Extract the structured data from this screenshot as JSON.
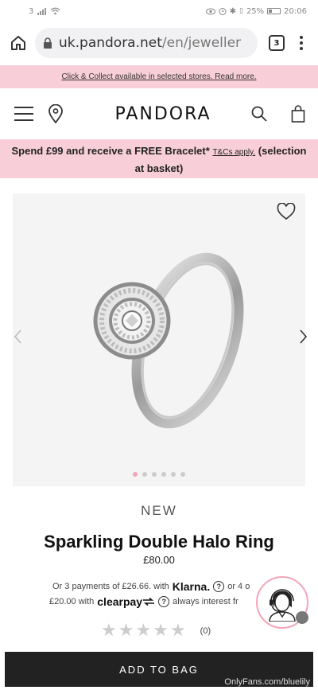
{
  "status_bar": {
    "left_text": "3",
    "battery": "25%",
    "time": "20:06"
  },
  "browser": {
    "url_host": "uk.pandora.net",
    "url_path": "/en/jeweller",
    "tab_count": "3"
  },
  "top_banner": {
    "text": "Click & Collect available in selected stores. Read more."
  },
  "header": {
    "logo": "PANDORA"
  },
  "promo": {
    "text_main": "Spend £99 and receive a FREE Bracelet*",
    "tc_link": "T&Cs apply.",
    "text_tail": "(selection at basket)"
  },
  "gallery": {
    "image_count": 6,
    "active_index": 0
  },
  "product": {
    "tag": "NEW",
    "title": "Sparkling Double Halo Ring",
    "price": "£80.00"
  },
  "payments": {
    "line1_prefix": "Or 3 payments of £26.66. with",
    "klarna": "Klarna.",
    "line1_suffix": "or 4 o",
    "line2_prefix": "£20.00 with",
    "clearpay": "clearpay",
    "line2_suffix": "always interest fr"
  },
  "rating": {
    "stars": 0,
    "count": "(0)"
  },
  "cta": {
    "add_to_bag": "ADD TO BAG"
  },
  "watermark": "OnlyFans.com/bluelily",
  "colors": {
    "banner_pink": "#f8cfd9",
    "cta_bg": "#222222",
    "dot_active": "#f2a6b8"
  }
}
